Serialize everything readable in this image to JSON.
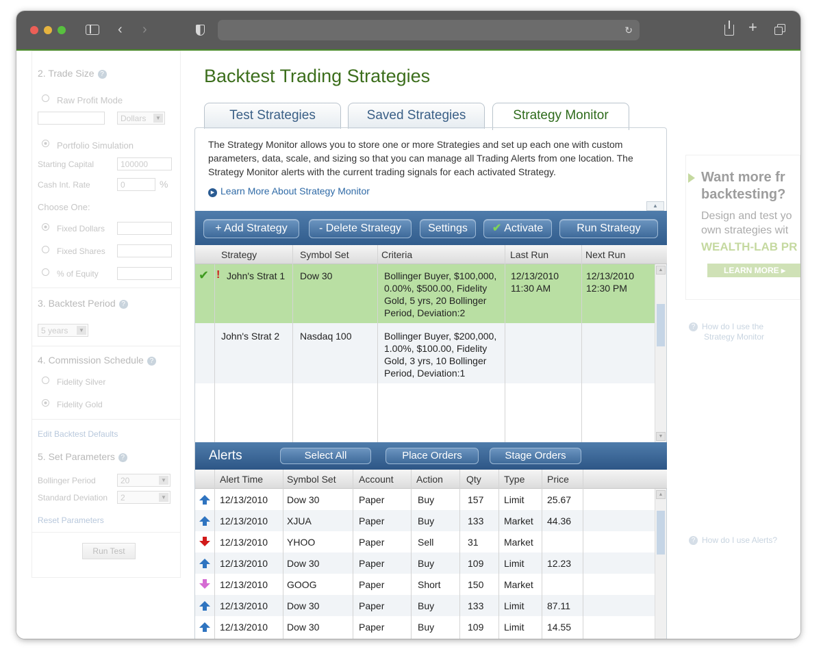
{
  "browser": {
    "address": ""
  },
  "sidebar": {
    "trade_size": {
      "heading": "2. Trade Size",
      "raw_profit_mode": "Raw Profit Mode",
      "dollars_select": "Dollars",
      "portfolio_simulation": "Portfolio Simulation",
      "starting_capital_label": "Starting Capital",
      "starting_capital_value": "100000",
      "cash_rate_label": "Cash Int. Rate",
      "cash_rate_value": "0",
      "percent": "%",
      "choose_one": "Choose One:",
      "fixed_dollars": "Fixed Dollars",
      "fixed_shares": "Fixed Shares",
      "pct_equity": "% of Equity"
    },
    "backtest_period": {
      "heading": "3. Backtest Period",
      "value": "5 years"
    },
    "commission": {
      "heading": "4. Commission Schedule",
      "silver": "Fidelity Silver",
      "gold": "Fidelity Gold",
      "defaults_link": "Edit Backtest Defaults"
    },
    "parameters": {
      "heading": "5. Set Parameters",
      "bollinger_label": "Bollinger Period",
      "bollinger_value": "20",
      "stddev_label": "Standard Deviation",
      "stddev_value": "2",
      "reset_link": "Reset Parameters",
      "run_button": "Run Test"
    }
  },
  "main": {
    "title": "Backtest Trading Strategies",
    "tabs": [
      {
        "label": "Test Strategies"
      },
      {
        "label": "Saved Strategies"
      },
      {
        "label": "Strategy Monitor"
      }
    ],
    "description": "The Strategy Monitor allows you to store one or more Strategies and set up each one with custom parameters, data, scale, and sizing so that you can manage all Trading Alerts from one location. The Strategy Monitor alerts with the current trading signals for each activated Strategy.",
    "learn_more": "Learn More About Strategy Monitor",
    "toolbar": {
      "add": "+ Add Strategy",
      "delete": "- Delete Strategy",
      "settings": "Settings",
      "activate": "Activate",
      "run": "Run Strategy"
    },
    "strategy_columns": [
      "Strategy",
      "Symbol Set",
      "Criteria",
      "Last Run",
      "Next Run"
    ],
    "strategies": [
      {
        "name": "John's Strat 1",
        "symbol_set": "Dow 30",
        "criteria": [
          "Bollinger Buyer, $100,000,",
          "0.00%, $500.00, Fidelity",
          "Gold, 5 yrs, 20 Bollinger",
          "Period, Deviation:2"
        ],
        "last_run": [
          "12/13/2010",
          "11:30 AM"
        ],
        "next_run": [
          "12/13/2010",
          "12:30 PM"
        ],
        "active": true,
        "alert_flag": "!"
      },
      {
        "name": "John's Strat 2",
        "symbol_set": "Nasdaq 100",
        "criteria": [
          "Bollinger Buyer, $200,000,",
          "1.00%, $100.00, Fidelity",
          "Gold, 3 yrs, 10 Bollinger",
          "Period, Deviation:1"
        ],
        "last_run": [
          "",
          ""
        ],
        "next_run": [
          "",
          ""
        ],
        "active": false,
        "alert_flag": ""
      }
    ],
    "alerts": {
      "title": "Alerts",
      "select_all": "Select All",
      "place_orders": "Place Orders",
      "stage_orders": "Stage Orders",
      "columns": [
        "Alert Time",
        "Symbol Set",
        "Account",
        "Action",
        "Qty",
        "Type",
        "Price"
      ],
      "rows": [
        {
          "dir": "up",
          "time": "12/13/2010",
          "symbol": "Dow 30",
          "account": "Paper",
          "action": "Buy",
          "qty": "157",
          "type": "Limit",
          "price": "25.67"
        },
        {
          "dir": "up",
          "time": "12/13/2010",
          "symbol": "XJUA",
          "account": "Paper",
          "action": "Buy",
          "qty": "133",
          "type": "Market",
          "price": "44.36"
        },
        {
          "dir": "down",
          "time": "12/13/2010",
          "symbol": "YHOO",
          "account": "Paper",
          "action": "Sell",
          "qty": "31",
          "type": "Market",
          "price": ""
        },
        {
          "dir": "up",
          "time": "12/13/2010",
          "symbol": "Dow 30",
          "account": "Paper",
          "action": "Buy",
          "qty": "109",
          "type": "Limit",
          "price": "12.23"
        },
        {
          "dir": "short",
          "time": "12/13/2010",
          "symbol": "GOOG",
          "account": "Paper",
          "action": "Short",
          "qty": "150",
          "type": "Market",
          "price": ""
        },
        {
          "dir": "up",
          "time": "12/13/2010",
          "symbol": "Dow 30",
          "account": "Paper",
          "action": "Buy",
          "qty": "133",
          "type": "Limit",
          "price": "87.11"
        },
        {
          "dir": "up",
          "time": "12/13/2010",
          "symbol": "Dow 30",
          "account": "Paper",
          "action": "Buy",
          "qty": "109",
          "type": "Limit",
          "price": "14.55"
        }
      ]
    }
  },
  "ad": {
    "headline_1": "Want more fr",
    "headline_2": "backtesting?",
    "text_1": "Design and test yo",
    "text_2": "own strategies wit",
    "brand": "WEALTH-LAB PR",
    "button": "LEARN MORE",
    "help_monitor_1": "How do I use the",
    "help_monitor_2": "Strategy Monitor",
    "help_alerts": "How do I use Alerts?"
  },
  "colors": {
    "accent": "#315c8c",
    "title_green": "#3c6e1c",
    "selected_row": "#b9dfa3",
    "up_arrow": "#2f74c0",
    "down_arrow": "#d11a1a",
    "short_arrow": "#d56bd3"
  }
}
